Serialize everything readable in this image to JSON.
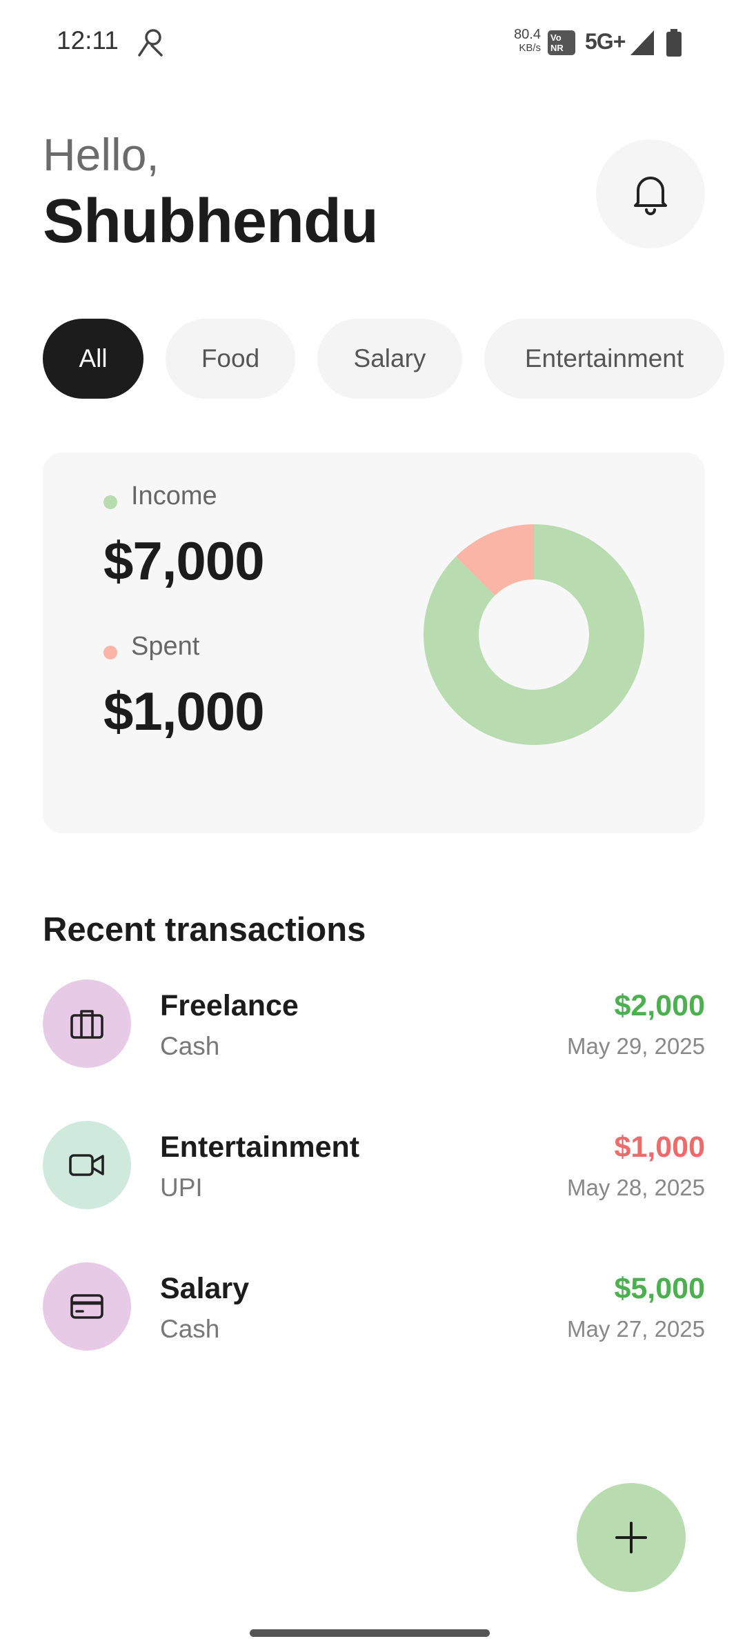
{
  "status_bar": {
    "time": "12:11",
    "speed_value": "80.4",
    "speed_unit": "KB/s",
    "vonr_top": "Vo",
    "vonr_bottom": "NR",
    "network": "5G+"
  },
  "header": {
    "greeting": "Hello,",
    "name": "Shubhendu"
  },
  "filters": [
    {
      "label": "All",
      "active": true
    },
    {
      "label": "Food",
      "active": false
    },
    {
      "label": "Salary",
      "active": false
    },
    {
      "label": "Entertainment",
      "active": false
    }
  ],
  "summary": {
    "income_label": "Income",
    "income_amount": "$7,000",
    "spent_label": "Spent",
    "spent_amount": "$1,000",
    "colors": {
      "income": "#b8dbb0",
      "spent": "#fbb5a7"
    }
  },
  "chart_data": {
    "type": "pie",
    "categories": [
      "Income",
      "Spent"
    ],
    "values": [
      7000,
      1000
    ],
    "colors": [
      "#b8dbb0",
      "#fbb5a7"
    ]
  },
  "recent": {
    "title": "Recent transactions",
    "items": [
      {
        "title": "Freelance",
        "method": "Cash",
        "amount": "$2,000",
        "date": "May 29, 2025",
        "type": "income",
        "icon": "briefcase-icon",
        "icon_bg": "#e7cbe6"
      },
      {
        "title": "Entertainment",
        "method": "UPI",
        "amount": "$1,000",
        "date": "May 28, 2025",
        "type": "expense",
        "icon": "video-camera-icon",
        "icon_bg": "#cfe9dd"
      },
      {
        "title": "Salary",
        "method": "Cash",
        "amount": "$5,000",
        "date": "May 27, 2025",
        "type": "income",
        "icon": "credit-card-icon",
        "icon_bg": "#e7cbe6"
      }
    ]
  },
  "colors": {
    "income_text": "#4caf50",
    "expense_text": "#ef6b6b",
    "fab": "#b8dbb0"
  },
  "fab_icon": "plus-icon"
}
